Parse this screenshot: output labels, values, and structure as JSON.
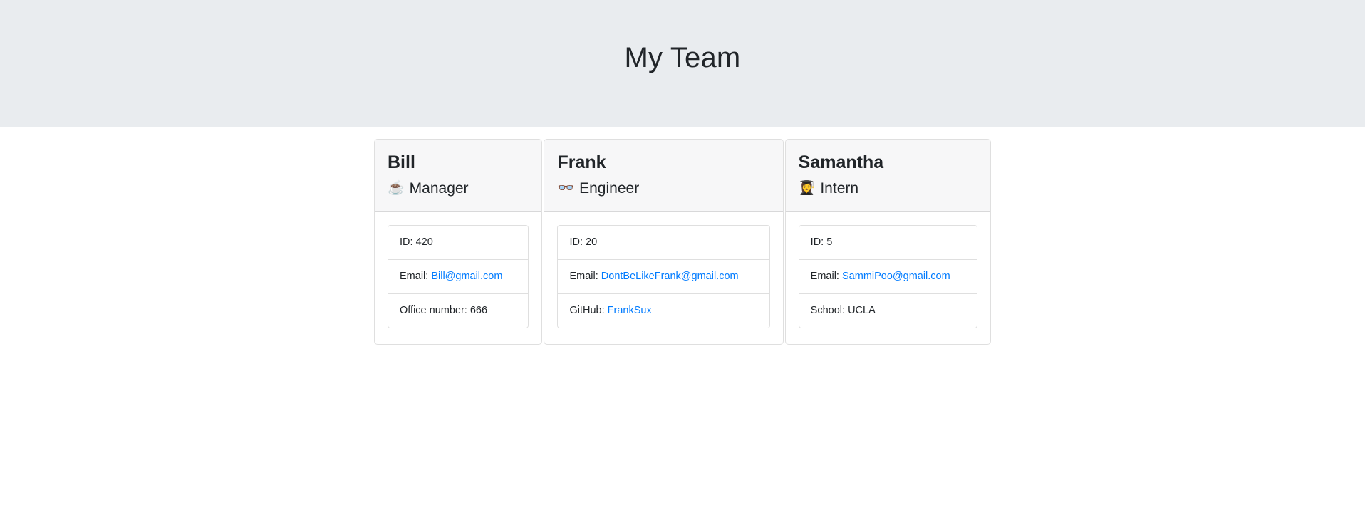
{
  "header": {
    "title": "My Team"
  },
  "team": [
    {
      "name": "Bill",
      "role": "Manager",
      "role_emoji": "☕",
      "role_emoji_name": "coffee-cup-icon",
      "items": [
        {
          "label": "ID: ",
          "value": "420",
          "is_link": false
        },
        {
          "label": "Email: ",
          "value": "Bill@gmail.com",
          "is_link": true
        },
        {
          "label": "Office number: ",
          "value": "666",
          "is_link": false
        }
      ]
    },
    {
      "name": "Frank",
      "role": "Engineer",
      "role_emoji": "👓",
      "role_emoji_name": "eyeglasses-icon",
      "items": [
        {
          "label": "ID: ",
          "value": "20",
          "is_link": false
        },
        {
          "label": "Email: ",
          "value": "DontBeLikeFrank@gmail.com",
          "is_link": true
        },
        {
          "label": "GitHub: ",
          "value": "FrankSux",
          "is_link": true
        }
      ]
    },
    {
      "name": "Samantha",
      "role": "Intern",
      "role_emoji": "👩‍🎓",
      "role_emoji_name": "graduate-icon",
      "items": [
        {
          "label": "ID: ",
          "value": "5",
          "is_link": false
        },
        {
          "label": "Email: ",
          "value": "SammiPoo@gmail.com",
          "is_link": true
        },
        {
          "label": "School: ",
          "value": "UCLA",
          "is_link": false
        }
      ]
    }
  ],
  "colors": {
    "jumbotron_bg": "#e9ecef",
    "link": "#007bff",
    "text": "#212529",
    "card_header_bg": "#f7f7f8",
    "border": "rgba(0,0,0,.125)"
  }
}
